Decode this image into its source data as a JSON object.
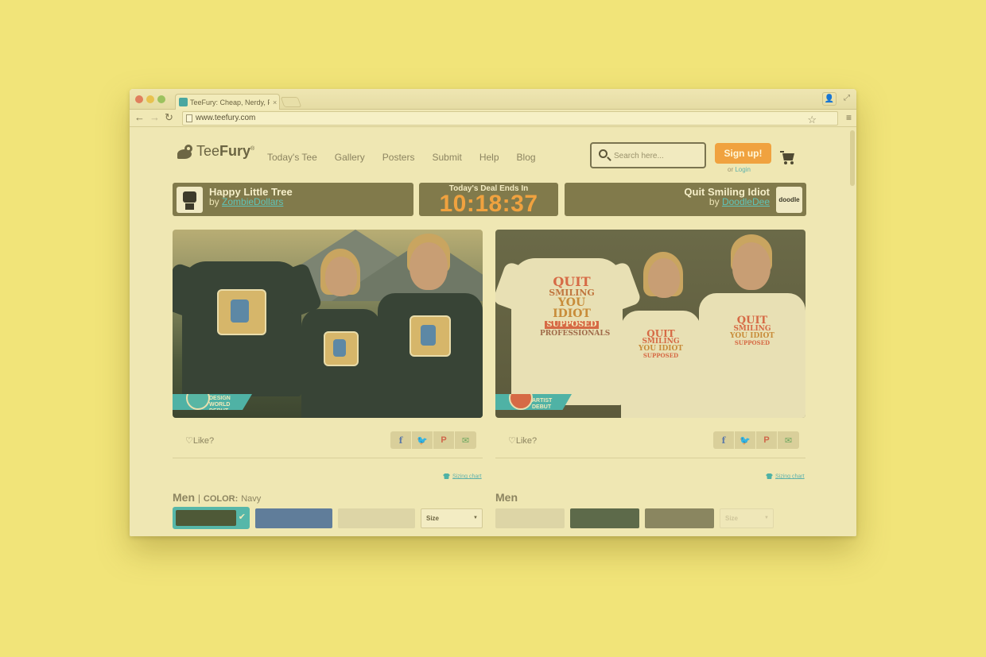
{
  "browser": {
    "tab_title": "TeeFury: Cheap, Nerdy, Po",
    "tab_close": "×",
    "url": "www.teefury.com"
  },
  "header": {
    "logo_text_light": "Tee",
    "logo_text_bold": "Fury",
    "logo_mark": "®",
    "nav": [
      "Today's Tee",
      "Gallery",
      "Posters",
      "Submit",
      "Help",
      "Blog"
    ],
    "search_placeholder": "Search here...",
    "signup_label": "Sign up!",
    "login_prefix": "or",
    "login_label": "Login"
  },
  "deal": {
    "label": "Today's Deal Ends In",
    "timer": "10:18:37"
  },
  "featured": [
    {
      "title": "Happy Little Tree",
      "by_prefix": "by",
      "artist": "ZombieDollars",
      "debut_badge": [
        "DESIGN",
        "WORLD",
        "DEBUT"
      ],
      "like_label": "Like?",
      "sizing_label": "Sizing chart",
      "gender": "Men",
      "color_prefix": "COLOR:",
      "color_name": "Navy",
      "size_placeholder": "Size"
    },
    {
      "title": "Quit Smiling Idiot",
      "by_prefix": "by",
      "artist": "DoodleDee",
      "avatar_text": "doodle",
      "debut_badge": [
        "ARTIST",
        "DEBUT"
      ],
      "print_lines": [
        "QUIT",
        "SMILING",
        "YOU IDIOT",
        "SUPPOSED",
        "PROFESSIONALS"
      ],
      "like_label": "Like?",
      "sizing_label": "Sizing chart",
      "gender": "Men",
      "size_placeholder": "Size"
    }
  ],
  "swatch_colors": {
    "left": [
      "#4e5937",
      "#607d9a",
      "#ddd5a6"
    ],
    "right": [
      "#ddd5a6",
      "#5d6a4a",
      "#8a8660"
    ]
  },
  "icons": [
    "search-icon",
    "cart-icon",
    "heart-icon",
    "facebook-icon",
    "twitter-icon",
    "pinterest-icon",
    "email-icon",
    "star-icon",
    "menu-icon",
    "back-icon",
    "forward-icon",
    "reload-icon"
  ]
}
